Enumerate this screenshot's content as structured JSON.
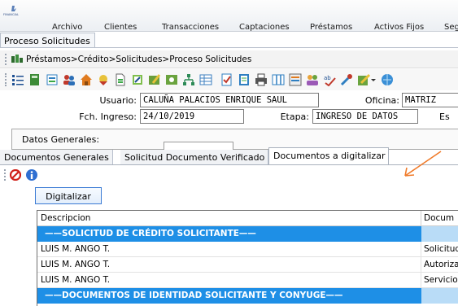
{
  "app": {
    "logo_text": "FINANCIAL"
  },
  "menu": {
    "items": [
      "Archivo",
      "Clientes",
      "Transacciones",
      "Captaciones",
      "Préstamos",
      "Activos Fijos",
      "Seg"
    ]
  },
  "document_tab": {
    "label": "Proceso Solicitudes"
  },
  "breadcrumb": {
    "text": "Préstamos>Crédito>Solicitudes>Proceso Solicitudes"
  },
  "toolbar": {
    "icons": [
      "list-icon",
      "book-icon",
      "form-icon",
      "users-icon",
      "home-icon",
      "bird-icon",
      "document-icon",
      "edit-document-icon",
      "pen-icon",
      "process-icon",
      "org-chart-icon",
      "grid-icon",
      "check-document-icon",
      "notebook-icon",
      "printer-icon",
      "columns-icon",
      "table-icon",
      "people-icon",
      "spellcheck-icon",
      "tools-icon",
      "edit-icon",
      "globe-icon"
    ]
  },
  "form": {
    "usuario_label": "Usuario:",
    "usuario_value": "CALUÑA PALACIOS ENRIQUE SAUL",
    "oficina_label": "Oficina:",
    "oficina_value": "MATRIZ",
    "fecha_label": "Fch. Ingreso:",
    "fecha_value": "24/10/2019",
    "etapa_label": "Etapa:",
    "etapa_value": "INGRESO DE DATOS",
    "es_label": "Es"
  },
  "datos_generales": {
    "label": "Datos Generales:"
  },
  "subtabs": {
    "items": [
      "Documentos Generales",
      "Solicitud Documento Verificado",
      "Documentos a digitalizar"
    ],
    "active_index": 2
  },
  "actions": {
    "digitalizar_label": "Digitalizar"
  },
  "grid": {
    "columns": [
      "Descripcion",
      "Docum"
    ],
    "rows": [
      {
        "type": "section",
        "descripcion": "——SOLICITUD DE CRÉDITO SOLICITANTE——",
        "documento": ""
      },
      {
        "type": "data",
        "descripcion": "LUIS M. ANGO T.",
        "documento": "Solicitud"
      },
      {
        "type": "data",
        "descripcion": "LUIS M. ANGO T.",
        "documento": "Autoriza"
      },
      {
        "type": "data",
        "descripcion": "LUIS M. ANGO T.",
        "documento": "Servicio"
      },
      {
        "type": "section",
        "descripcion": "——DOCUMENTOS DE IDENTIDAD SOLICITANTE Y CONYUGE——",
        "documento": ""
      }
    ]
  },
  "colors": {
    "section_row": "#1e8fe6",
    "section_row_side": "#b9dcf7",
    "annotation_arrow": "#f07b2a",
    "button_border": "#3b7bd4"
  }
}
